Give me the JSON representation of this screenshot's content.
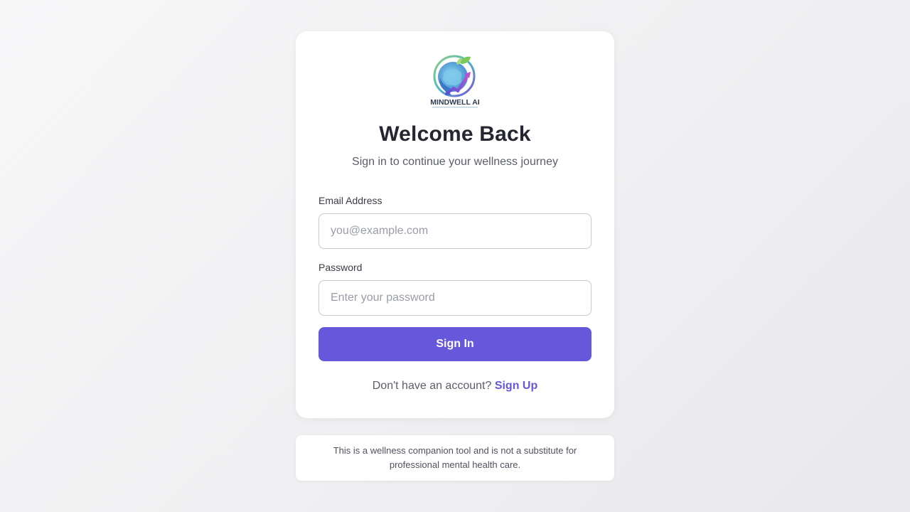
{
  "brand": {
    "logo_text": "MINDWELL AI",
    "logo_icon": "brain-globe-growth-logo",
    "accent_color": "#6558db"
  },
  "login": {
    "title": "Welcome Back",
    "subtitle": "Sign in to continue your wellness journey",
    "email_label": "Email Address",
    "email_placeholder": "you@example.com",
    "email_value": "",
    "password_label": "Password",
    "password_placeholder": "Enter your password",
    "password_value": "",
    "submit_label": "Sign In",
    "signup_prompt": "Don't have an account?",
    "signup_link": "Sign Up"
  },
  "disclaimer": {
    "text": "This is a wellness companion tool and is not a substitute for professional mental health care."
  }
}
